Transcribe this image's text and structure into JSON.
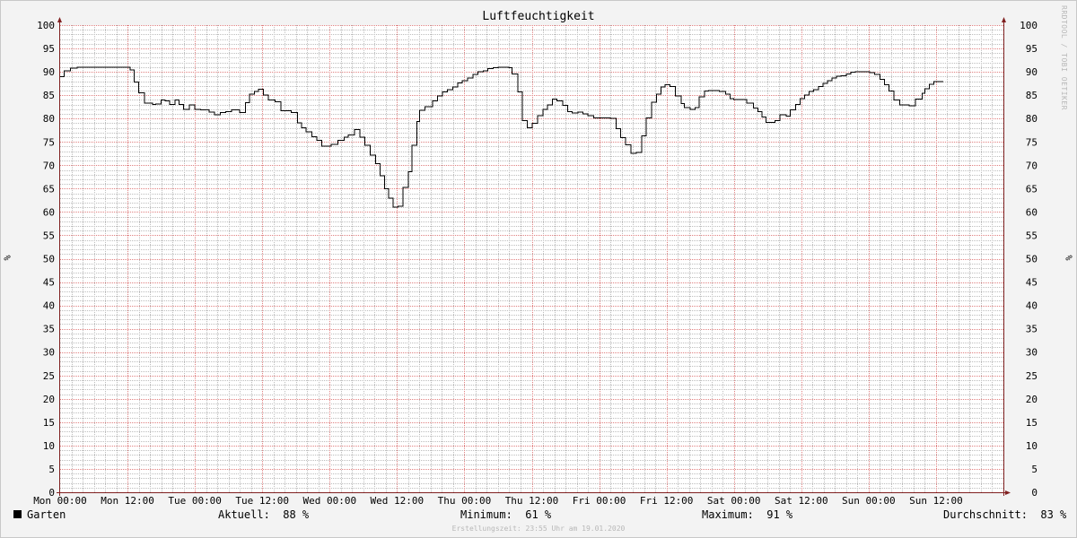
{
  "chart_data": {
    "type": "line",
    "title": "Luftfeuchtigkeit",
    "ylabel": "%",
    "ylim": [
      0,
      100
    ],
    "yticks": [
      0,
      5,
      10,
      15,
      20,
      25,
      30,
      35,
      40,
      45,
      50,
      55,
      60,
      65,
      70,
      75,
      80,
      85,
      90,
      95,
      100
    ],
    "xlim_hours": [
      0,
      168
    ],
    "xtick_labels": [
      "Mon 00:00",
      "Mon 12:00",
      "Tue 00:00",
      "Tue 12:00",
      "Wed 00:00",
      "Wed 12:00",
      "Thu 00:00",
      "Thu 12:00",
      "Fri 00:00",
      "Fri 12:00",
      "Sat 00:00",
      "Sat 12:00",
      "Sun 00:00",
      "Sun 12:00"
    ],
    "grid": true,
    "legend_position": "bottom",
    "series": [
      {
        "name": "Garten",
        "color": "#000000",
        "x_hours": [
          0,
          0.7,
          1.8,
          3,
          6,
          9,
          11.5,
          12,
          12.5,
          13.2,
          14,
          15,
          16.5,
          17,
          18,
          18.7,
          19.5,
          20.5,
          21.2,
          22,
          23,
          24,
          25,
          26.5,
          27.5,
          28.5,
          29.5,
          30.5,
          32,
          33,
          33.7,
          34.6,
          35.3,
          36.2,
          37.1,
          38.3,
          39.3,
          40.3,
          41.2,
          42.3,
          43,
          43.8,
          44.8,
          45.7,
          46.6,
          47.3,
          48.3,
          49.5,
          50.6,
          51.3,
          52.4,
          53.4,
          54.3,
          55.2,
          56.2,
          57,
          57.8,
          58.5,
          59.3,
          60.2,
          61.1,
          62,
          62.7,
          63.5,
          64,
          65,
          66.3,
          67.2,
          68.1,
          69,
          69.9,
          70.8,
          71.6,
          72.6,
          73.5,
          74.4,
          75.4,
          76.2,
          77.1,
          78,
          79,
          79.9,
          80.5,
          81.5,
          82.3,
          83.2,
          84.1,
          85,
          86,
          86.8,
          87.7,
          88.5,
          89.5,
          90.4,
          91.2,
          92.2,
          93.1,
          94,
          95,
          96,
          97,
          98,
          99,
          99.8,
          100.7,
          101.7,
          102.6,
          103.6,
          104.4,
          105.3,
          106.2,
          107,
          107.7,
          108.6,
          109.6,
          110.6,
          111.2,
          112.2,
          113.1,
          113.8,
          114.8,
          115.5,
          116.5,
          117.4,
          118.5,
          119.3,
          120,
          121.6,
          122.3,
          123.5,
          124.3,
          125,
          125.7,
          126.5,
          127.3,
          128.2,
          129.3,
          130,
          131,
          131.8,
          132.6,
          133.4,
          134.2,
          135.1,
          135.9,
          136.7,
          137.5,
          138.3,
          139.1,
          140,
          140.8,
          141.6,
          142.5,
          143.3,
          144.2,
          145.1,
          146,
          146.8,
          147.6,
          148.5,
          149.5,
          150.4,
          151.2,
          152.3,
          153.5,
          154,
          154.8,
          155.6,
          156.5,
          157.3,
          158.6,
          159.5,
          160.4,
          161.2,
          162.1,
          162.9,
          163.7,
          164.6
        ],
        "y": [
          89,
          90.2,
          90.8,
          91,
          91,
          91,
          91,
          91,
          90.4,
          87.8,
          85.5,
          83.3,
          83,
          83.1,
          84,
          83.8,
          83,
          84,
          83,
          82,
          82.9,
          82,
          81.9,
          81.4,
          80.8,
          81.3,
          81.5,
          81.9,
          81.3,
          83.4,
          85.2,
          85.8,
          86.3,
          85,
          84,
          83.6,
          81.7,
          81.7,
          81.3,
          79.1,
          78,
          77.2,
          76.1,
          75.3,
          74.1,
          74.1,
          74.5,
          75.3,
          76,
          76.5,
          77.6,
          76,
          74.3,
          72.2,
          70.3,
          67.8,
          65,
          63,
          61,
          61.2,
          65.3,
          68.6,
          74.3,
          79.4,
          81.8,
          82.5,
          83.8,
          84.8,
          85.7,
          86.2,
          86.8,
          87.6,
          88.1,
          88.7,
          89.4,
          90,
          90.2,
          90.7,
          90.9,
          91,
          91,
          90.9,
          89.5,
          85.7,
          79.6,
          78,
          79,
          80.6,
          82,
          82.9,
          84.2,
          83.8,
          82.8,
          81.5,
          81.2,
          81.4,
          81,
          80.6,
          80.1,
          80.1,
          80.1,
          80,
          77.8,
          75.9,
          74.4,
          72.6,
          72.7,
          76.3,
          80.1,
          83.5,
          85.2,
          86.8,
          87.2,
          86.9,
          84.8,
          83.2,
          82.3,
          82,
          82.3,
          84.6,
          85.9,
          86,
          86,
          85.8,
          85.2,
          84.3,
          84.1,
          84.1,
          83.3,
          82.2,
          81.5,
          80.3,
          79.2,
          79.2,
          79.6,
          80.8,
          80.5,
          81.9,
          83,
          84.3,
          85,
          85.8,
          86.2,
          86.9,
          87.5,
          88.1,
          88.7,
          89.1,
          89.2,
          89.5,
          89.9,
          90,
          90,
          90,
          89.8,
          89.4,
          88.4,
          87.2,
          85.9,
          84,
          82.9,
          82.9,
          82.7,
          84.2,
          85.4,
          86.4,
          87.3,
          87.9,
          87.9
        ]
      }
    ]
  },
  "legend": {
    "series_name": "Garten",
    "current_label": "Aktuell:",
    "current_value": "88 %",
    "min_label": "Minimum:",
    "min_value": "61 %",
    "max_label": "Maximum:",
    "max_value": "91 %",
    "avg_label": "Durchschnitt:",
    "avg_value": "83 %"
  },
  "footer": "Erstellungszeit: 23:55 Uhr am 19.01.2020",
  "watermark": "RRDTOOL / TOBI OETIKER",
  "colors": {
    "grid_major": "#e08080",
    "grid_minor": "#bdbdbd",
    "axis": "#802020",
    "plot_background": "#ffffff",
    "line": "#000000"
  }
}
